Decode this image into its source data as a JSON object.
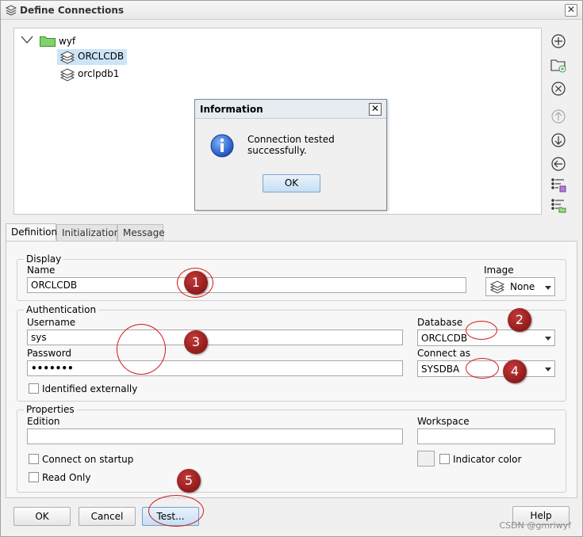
{
  "window": {
    "title": "Define Connections",
    "close_glyph": "✕"
  },
  "tree": {
    "folder_label": "wyf",
    "nodes": [
      {
        "label": "ORCLCDB",
        "selected": true
      },
      {
        "label": "orclpdb1",
        "selected": false
      }
    ]
  },
  "toolbar": {
    "icons": [
      "add-icon",
      "new-folder-icon",
      "remove-icon",
      "move-up-icon",
      "move-down-icon",
      "back-icon",
      "save-list-icon",
      "list-folder-icon"
    ]
  },
  "info_dialog": {
    "title": "Information",
    "close_glyph": "✕",
    "message": "Connection tested successfully.",
    "ok_label": "OK"
  },
  "tabs": [
    {
      "label": "Definition",
      "active": true
    },
    {
      "label": "Initialization",
      "active": false
    },
    {
      "label": "Message",
      "active": false
    }
  ],
  "display": {
    "legend": "Display",
    "name_label": "Name",
    "name_value": "ORCLCDB",
    "image_label": "Image",
    "image_value": "None"
  },
  "authentication": {
    "legend": "Authentication",
    "username_label": "Username",
    "username_value": "sys",
    "password_label": "Password",
    "password_value": "•••••••",
    "database_label": "Database",
    "database_value": "ORCLCDB",
    "connect_as_label": "Connect as",
    "connect_as_value": "SYSDBA",
    "identified_externally_label": "Identified externally"
  },
  "properties": {
    "legend": "Properties",
    "edition_label": "Edition",
    "edition_value": "",
    "workspace_label": "Workspace",
    "workspace_value": "",
    "connect_on_startup_label": "Connect on startup",
    "read_only_label": "Read Only",
    "indicator_color_label": "Indicator color"
  },
  "buttons": {
    "ok": "OK",
    "cancel": "Cancel",
    "test": "Test...",
    "help": "Help"
  },
  "annotations": [
    "1",
    "2",
    "3",
    "4",
    "5"
  ],
  "watermark": "CSDN @gmriwyf",
  "colors": {
    "annotation_red": "#d21a1a",
    "selection_blue": "#cce4f7",
    "folder_green": "#7fd36b"
  }
}
